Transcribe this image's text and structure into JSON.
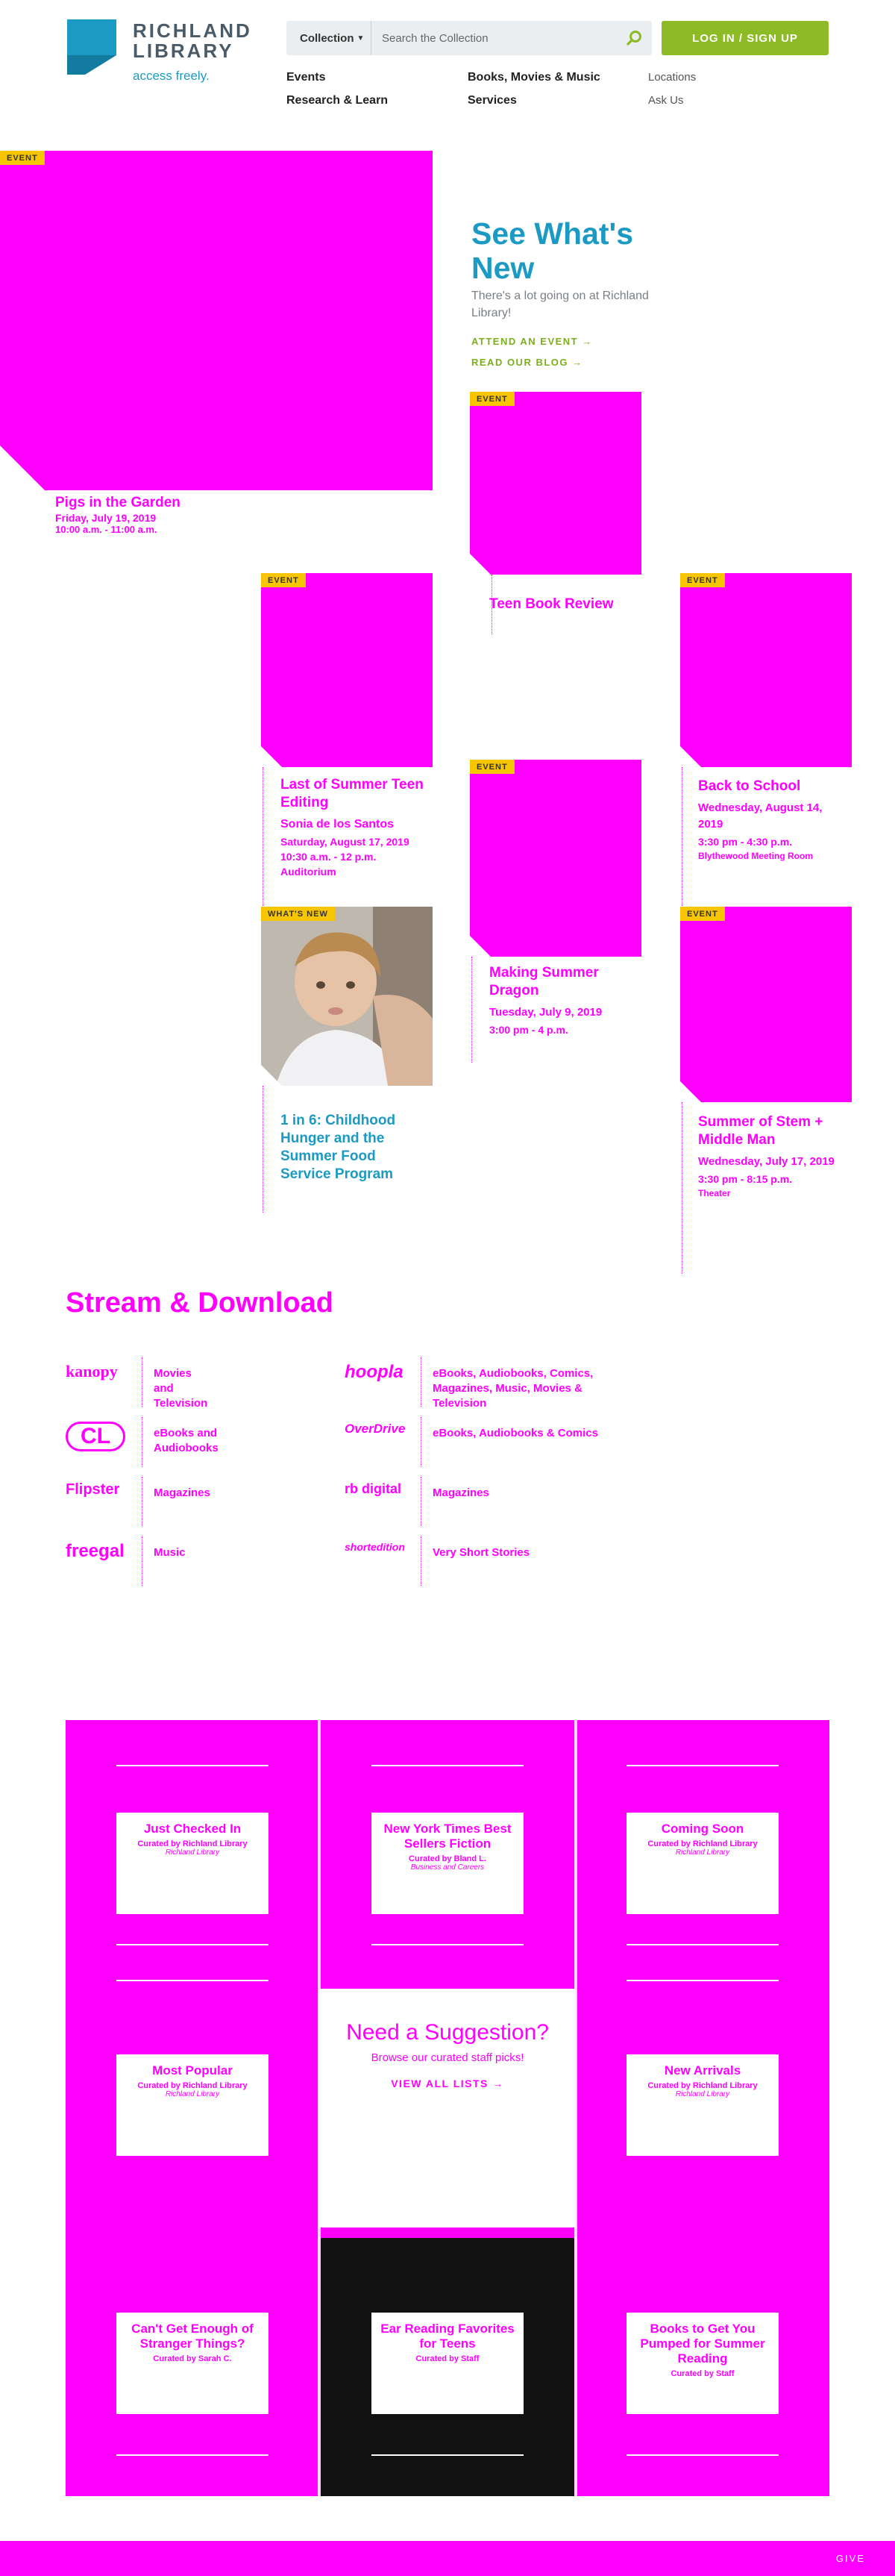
{
  "header": {
    "logo_word_1": "RICHLAND",
    "logo_word_2": "LIBRARY",
    "logo_tagline": "access freely.",
    "logo_mark": "richland-logo-icon",
    "search_scope": "Collection",
    "search_placeholder": "Search the Collection",
    "login_label": "LOG IN / SIGN UP",
    "nav": {
      "events": "Events",
      "books": "Books, Movies & Music",
      "locations": "Locations",
      "research": "Research & Learn",
      "services": "Services",
      "ask": "Ask Us"
    }
  },
  "colors": {
    "teal": "#1b9ac4",
    "green": "#8dbb25",
    "tag_yellow": "#f7c600",
    "placeholder_magenta": "#ff00ff",
    "logo_gray": "#4a5a66"
  },
  "whats_new": {
    "title": "See What's New",
    "description": "There's a lot going on at Richland Library!",
    "attend_link": "ATTEND AN EVENT →",
    "blog_link": "READ OUR BLOG →",
    "hero": {
      "tag": "EVENT",
      "title": "Pigs in the Garden",
      "date": "Friday, July 19, 2019",
      "time": "10:00 a.m. - 11:00 a.m."
    },
    "cards": [
      {
        "tag": "EVENT",
        "title": "Teen Book Review",
        "sub": "",
        "time": ""
      },
      {
        "tag": "EVENT",
        "title": "Last of Summer Teen Editing",
        "sub": "Sonia de los Santos",
        "date": "Saturday, August 17, 2019",
        "time": "10:30 a.m. - 12 p.m.",
        "place": "Auditorium"
      },
      {
        "tag": "EVENT",
        "title": "Back to School",
        "date": "Wednesday, August 14, 2019",
        "time": "3:30 pm - 4:30 p.m.",
        "place": "Blythewood Meeting Room"
      },
      {
        "tag": "EVENT",
        "title": "Making Summer Dragon",
        "date": "Tuesday, July 9, 2019",
        "time": "3:00 pm - 4 p.m."
      },
      {
        "tag": "WHAT'S NEW",
        "title": "1 in 6: Childhood Hunger and the Summer Food Service Program"
      },
      {
        "tag": "EVENT",
        "title": "Summer of Stem + Middle Man",
        "date": "Wednesday, July 17, 2019",
        "time": "3:30 pm - 8:15 p.m.",
        "place": "Theater"
      }
    ]
  },
  "stream": {
    "title": "Stream & Download",
    "left": [
      {
        "logo": "kanopy",
        "desc": "Movies and Television"
      },
      {
        "logo": "CL",
        "desc": "eBooks and Audiobooks"
      },
      {
        "logo": "Flipster",
        "desc": "Magazines"
      },
      {
        "logo": "freegal",
        "desc": "Music"
      }
    ],
    "right": [
      {
        "logo": "hoopla",
        "desc": "eBooks, Audiobooks, Comics, Magazines, Music, Movies & Television"
      },
      {
        "logo": "OverDrive",
        "desc": "eBooks, Audiobooks & Comics"
      },
      {
        "logo": "rb digital",
        "desc": "Magazines"
      },
      {
        "logo": "shortedition",
        "desc": "Very Short Stories"
      }
    ]
  },
  "lists": {
    "cells": [
      {
        "title": "Just Checked In",
        "by": "Curated by Richland Library",
        "cur": "Richland Library"
      },
      {
        "title": "New York Times Best Sellers Fiction",
        "by": "Curated by Bland L.",
        "cur": "Business and Careers"
      },
      {
        "title": "Coming Soon",
        "by": "Curated by Richland Library",
        "cur": "Richland Library"
      },
      {
        "title": "Most Popular",
        "by": "Curated by Richland Library",
        "cur": "Richland Library"
      },
      {
        "title": "New Arrivals",
        "by": "Curated by Richland Library",
        "cur": "Richland Library"
      },
      {
        "title": "Can't Get Enough of Stranger Things?",
        "by": "Curated by Sarah C.",
        "cur": ""
      },
      {
        "title": "Ear Reading Favorites for Teens",
        "by": "Curated by Staff",
        "cur": ""
      },
      {
        "title": "Books to Get You Pumped for Summer Reading",
        "by": "Curated by Staff",
        "cur": ""
      }
    ],
    "suggestion": {
      "title": "Need a Suggestion?",
      "desc": "Browse our curated staff picks!",
      "link": "VIEW ALL LISTS →"
    }
  },
  "footer": {
    "give": "GIVE"
  }
}
